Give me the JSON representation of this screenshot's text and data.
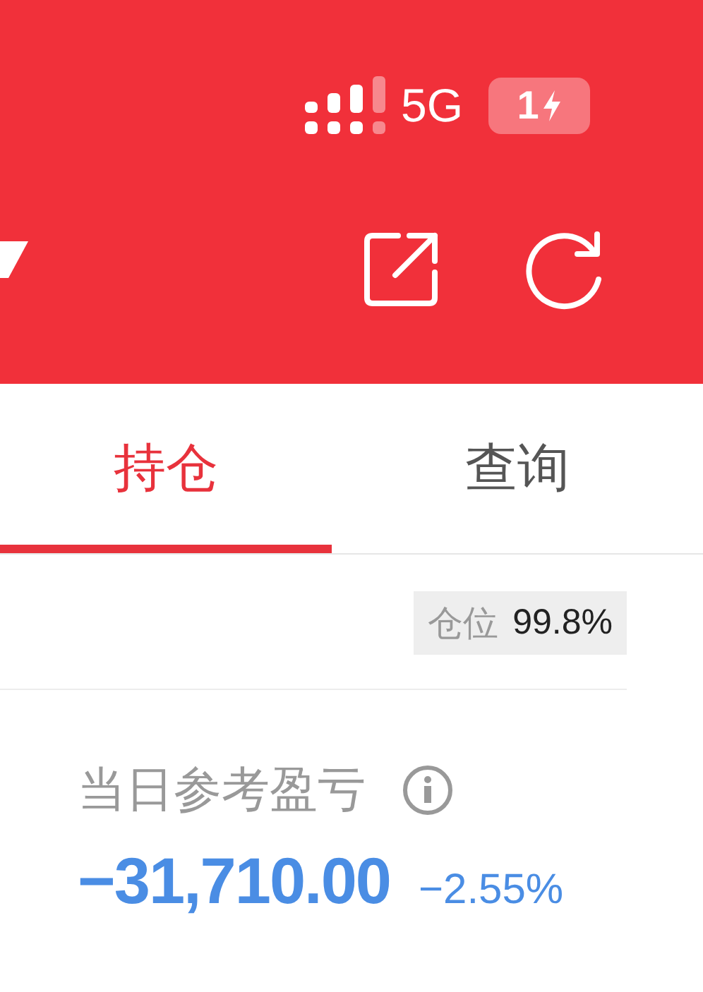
{
  "status_bar": {
    "network": "5G",
    "battery": "1"
  },
  "tabs": [
    {
      "label": "持仓",
      "selected": true
    },
    {
      "label": "查询",
      "selected": false
    }
  ],
  "position": {
    "label": "仓位",
    "value": "99.8%"
  },
  "pnl": {
    "label": "当日参考盈亏",
    "amount": "−31,710.00",
    "percent": "−2.55%"
  }
}
